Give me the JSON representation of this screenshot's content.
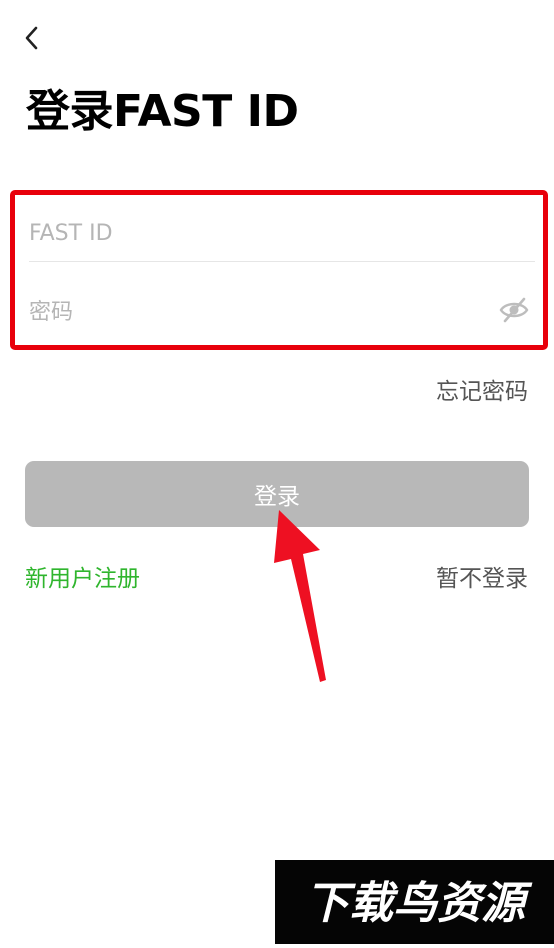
{
  "nav": {
    "back_icon": "chevron-left-icon"
  },
  "header": {
    "title": "登录FAST ID"
  },
  "form": {
    "id_placeholder": "FAST ID",
    "id_value": "",
    "password_placeholder": "密码",
    "password_value": "",
    "eye_icon": "eye-off-icon"
  },
  "links": {
    "forgot": "忘记密码",
    "register": "新用户注册",
    "skip": "暂不登录"
  },
  "actions": {
    "login_label": "登录"
  },
  "watermark": {
    "text": "下载鸟资源"
  },
  "colors": {
    "highlight": "#e8000b",
    "register": "#2fb52d",
    "button_disabled": "#b8b8b8",
    "muted_text": "#555555"
  }
}
